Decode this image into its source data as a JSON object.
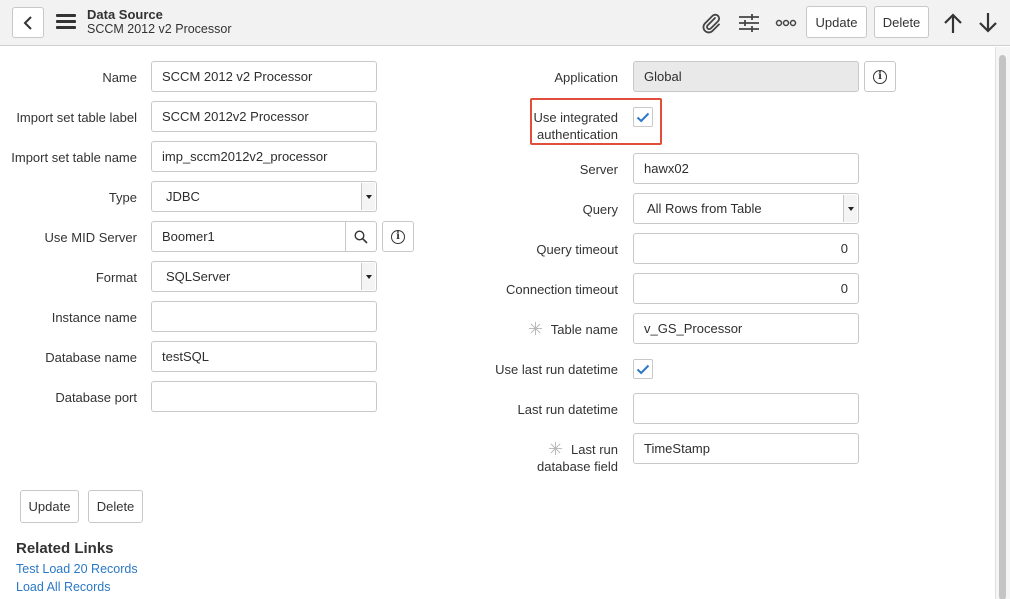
{
  "header": {
    "title": "Data Source",
    "subtitle": "SCCM 2012 v2 Processor",
    "update_label": "Update",
    "delete_label": "Delete"
  },
  "form_left": {
    "name": {
      "label": "Name",
      "value": "SCCM 2012 v2 Processor"
    },
    "import_label": {
      "label": "Import set table label",
      "value": "SCCM 2012v2 Processor"
    },
    "import_name": {
      "label": "Import set table name",
      "value": "imp_sccm2012v2_processor"
    },
    "type": {
      "label": "Type",
      "value": "JDBC"
    },
    "mid_server": {
      "label": "Use MID Server",
      "value": "Boomer1"
    },
    "format": {
      "label": "Format",
      "value": "SQLServer"
    },
    "instance": {
      "label": "Instance name",
      "value": ""
    },
    "database": {
      "label": "Database name",
      "value": "testSQL"
    },
    "port": {
      "label": "Database port",
      "value": ""
    }
  },
  "form_right": {
    "application": {
      "label": "Application",
      "value": "Global"
    },
    "integrated_auth": {
      "label_line1": "Use integrated",
      "label_line2": "authentication",
      "checked": true
    },
    "server": {
      "label": "Server",
      "value": "hawx02"
    },
    "query": {
      "label": "Query",
      "value": "All Rows from Table"
    },
    "query_timeout": {
      "label": "Query timeout",
      "value": "0"
    },
    "connection_timeout": {
      "label": "Connection timeout",
      "value": "0"
    },
    "table_name": {
      "label": "Table name",
      "value": "v_GS_Processor"
    },
    "use_last_run": {
      "label": "Use last run datetime",
      "checked": true
    },
    "last_run": {
      "label": "Last run datetime",
      "value": ""
    },
    "last_run_field": {
      "label_line1": "Last run",
      "label_line2": "database field",
      "value": "TimeStamp"
    }
  },
  "footer": {
    "update_label": "Update",
    "delete_label": "Delete"
  },
  "related_links": {
    "title": "Related Links",
    "items": [
      "Test Load 20 Records",
      "Load All Records"
    ]
  },
  "colors": {
    "accent_blue": "#2b78c6",
    "highlight_red": "#e14f3c",
    "header_bg": "#f2f2f2"
  },
  "icons": [
    "back-arrow-icon",
    "hamburger-menu-icon",
    "paperclip-icon",
    "sliders-icon",
    "more-icon",
    "arrow-up-icon",
    "arrow-down-icon",
    "search-icon",
    "info-icon",
    "checkmark-icon",
    "asterisk-icon"
  ]
}
